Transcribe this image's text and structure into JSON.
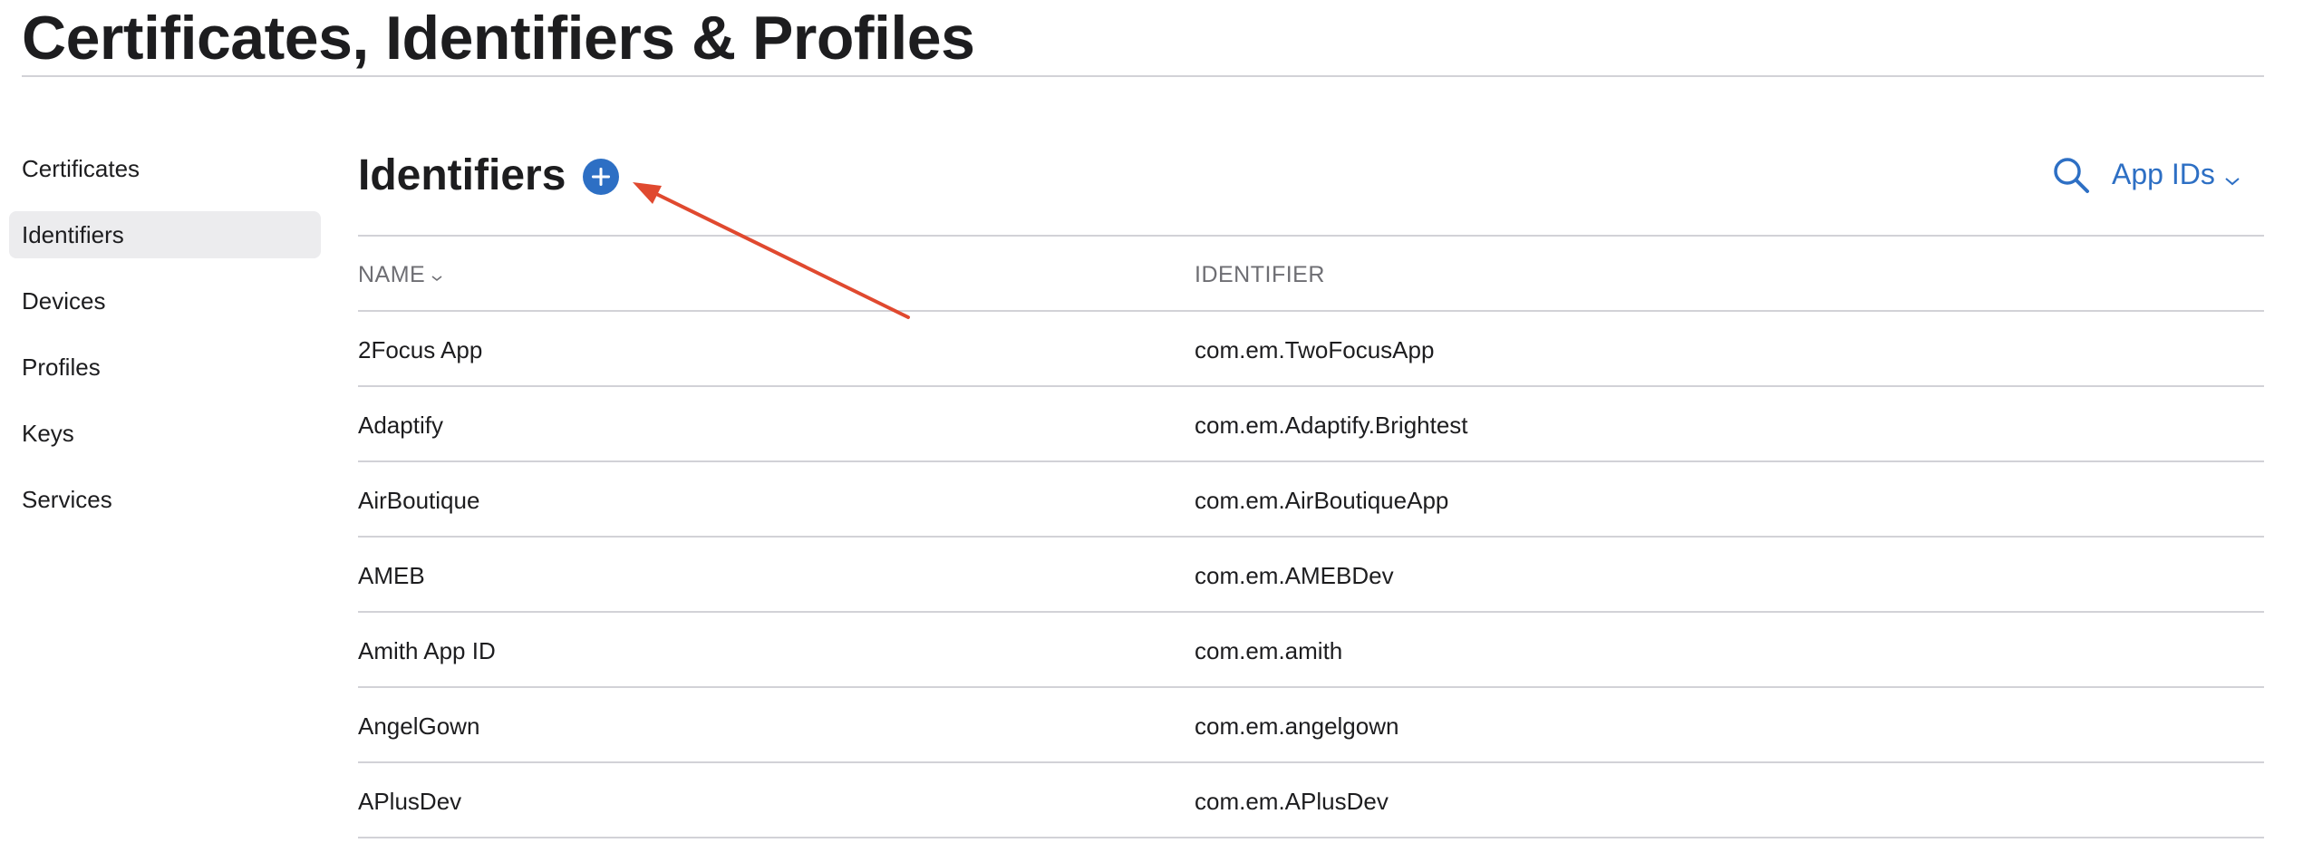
{
  "page": {
    "title": "Certificates, Identifiers & Profiles"
  },
  "sidebar": {
    "items": [
      {
        "label": "Certificates",
        "active": false
      },
      {
        "label": "Identifiers",
        "active": true
      },
      {
        "label": "Devices",
        "active": false
      },
      {
        "label": "Profiles",
        "active": false
      },
      {
        "label": "Keys",
        "active": false
      },
      {
        "label": "Services",
        "active": false
      }
    ]
  },
  "section": {
    "title": "Identifiers",
    "add_icon": "plus-circle-icon",
    "search_icon": "search-icon",
    "filter_label": "App IDs",
    "filter_icon": "chevron-down-icon"
  },
  "table": {
    "columns": [
      {
        "label": "NAME",
        "sortable": true
      },
      {
        "label": "IDENTIFIER",
        "sortable": false
      }
    ],
    "rows": [
      {
        "name": "2Focus App",
        "identifier": "com.em.TwoFocusApp"
      },
      {
        "name": "Adaptify",
        "identifier": "com.em.Adaptify.Brightest"
      },
      {
        "name": "AirBoutique",
        "identifier": "com.em.AirBoutiqueApp"
      },
      {
        "name": "AMEB",
        "identifier": "com.em.AMEBDev"
      },
      {
        "name": "Amith App ID",
        "identifier": "com.em.amith"
      },
      {
        "name": "AngelGown",
        "identifier": "com.em.angelgown"
      },
      {
        "name": "APlusDev",
        "identifier": "com.em.APlusDev"
      }
    ]
  },
  "colors": {
    "accent": "#2d6fc4",
    "annotation": "#e0492f",
    "text": "#1d1d1f",
    "muted": "#6e6e73",
    "divider": "#d2d2d7",
    "active_bg": "#ececee"
  }
}
